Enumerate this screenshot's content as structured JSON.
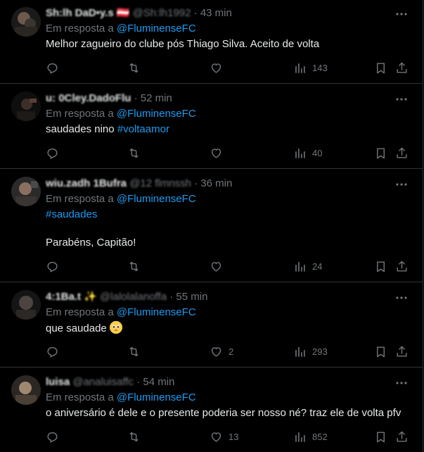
{
  "reply_prefix": "Em resposta a",
  "tweets": [
    {
      "name": "Sh:lh DaD•y.s 🇦🇹",
      "handle": "@Sh:lh1992",
      "time": "· 43 min",
      "mention": "@FluminenseFC",
      "text": "Melhor zagueiro do clube pós Thiago Silva. Aceito de volta",
      "tag": "",
      "text2": "",
      "reply_count": "",
      "retweet_count": "",
      "like_count": "",
      "view_count": "143"
    },
    {
      "name": "u: 0Cley.DadoFlu",
      "handle": "",
      "time": "· 52 min",
      "mention": "@FluminenseFC",
      "text": "saudades nino ",
      "tag": "#voltaamor",
      "text2": "",
      "reply_count": "",
      "retweet_count": "",
      "like_count": "",
      "view_count": "40"
    },
    {
      "name": "wiu.zadh 1Bufra",
      "handle": "@12 flmnssh",
      "time": "· 36 min",
      "mention": "@FluminenseFC",
      "text": "",
      "tag": "#saudades",
      "text2": "Parabéns, Capitão!",
      "reply_count": "",
      "retweet_count": "",
      "like_count": "",
      "view_count": "24"
    },
    {
      "name": "4:1Ba.t ✨",
      "handle": "@lalolalanoffa",
      "time": "· 55 min",
      "mention": "@FluminenseFC",
      "text": "que saudade ",
      "tag": "",
      "text2": "",
      "reply_count": "",
      "retweet_count": "",
      "like_count": "2",
      "view_count": "293"
    },
    {
      "name": "luisa",
      "handle": "@analuisaffc",
      "time": "· 54 min",
      "mention": "@FluminenseFC",
      "text": "o aniversário é dele e o presente poderia ser nosso né? traz ele de volta pfv",
      "tag": "",
      "text2": "",
      "reply_count": "",
      "retweet_count": "",
      "like_count": "13",
      "view_count": "852"
    }
  ]
}
